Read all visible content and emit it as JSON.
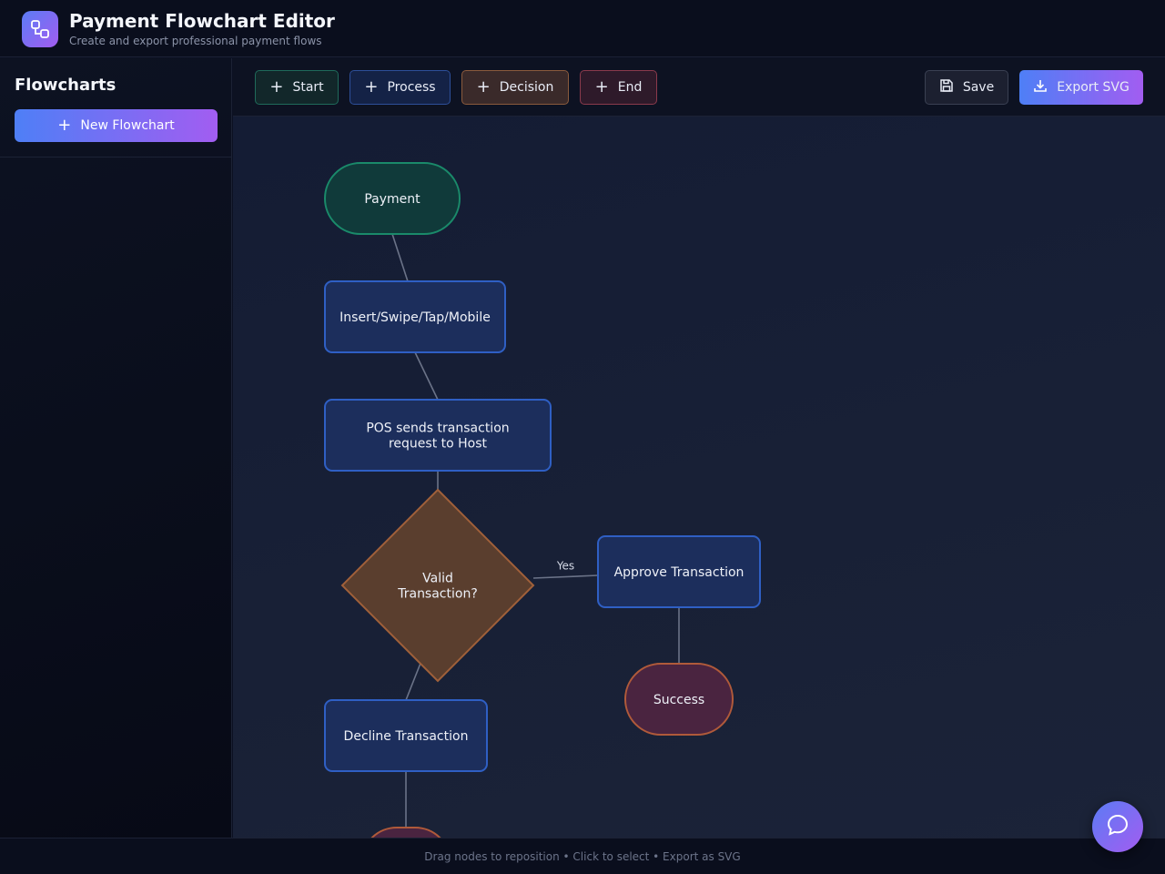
{
  "app": {
    "title": "Payment Flowchart Editor",
    "subtitle": "Create and export professional payment flows",
    "logo_icon": "flowchart-icon"
  },
  "sidebar": {
    "title": "Flowcharts",
    "new_button": "New Flowchart"
  },
  "toolbar": {
    "start": "Start",
    "process": "Process",
    "decision": "Decision",
    "end": "End",
    "save": "Save",
    "export": "Export SVG"
  },
  "flowchart": {
    "nodes": [
      {
        "id": "payment",
        "type": "start",
        "lines": [
          "Payment"
        ]
      },
      {
        "id": "insert",
        "type": "process",
        "lines": [
          "Insert/Swipe/Tap/Mobile"
        ]
      },
      {
        "id": "pos",
        "type": "process",
        "lines": [
          "POS sends transaction",
          "request to Host"
        ]
      },
      {
        "id": "valid",
        "type": "decision",
        "lines": [
          "Valid",
          "Transaction?"
        ]
      },
      {
        "id": "approve",
        "type": "process",
        "lines": [
          "Approve Transaction"
        ]
      },
      {
        "id": "success",
        "type": "end",
        "lines": [
          "Success"
        ]
      },
      {
        "id": "decline",
        "type": "process",
        "lines": [
          "Decline Transaction"
        ]
      },
      {
        "id": "failure",
        "type": "end",
        "lines": []
      }
    ],
    "edges": [
      {
        "from": "payment",
        "to": "insert",
        "label": ""
      },
      {
        "from": "insert",
        "to": "pos",
        "label": ""
      },
      {
        "from": "pos",
        "to": "valid",
        "label": ""
      },
      {
        "from": "valid",
        "to": "approve",
        "label": "Yes"
      },
      {
        "from": "approve",
        "to": "success",
        "label": ""
      },
      {
        "from": "valid",
        "to": "decline",
        "label": ""
      },
      {
        "from": "decline",
        "to": "failure",
        "label": ""
      }
    ]
  },
  "footer": {
    "hint": "Drag nodes to reposition • Click to select • Export as SVG"
  },
  "colors": {
    "start_fill": "#103a3a",
    "start_stroke": "#1a8a6a",
    "process_fill": "#1c2e5c",
    "process_stroke": "#2f5fc4",
    "decision_fill": "#5a3e2e",
    "decision_stroke": "#a0603a",
    "end_fill": "#4a2440",
    "end_stroke": "#b05a3a",
    "edge": "#6b7388"
  }
}
